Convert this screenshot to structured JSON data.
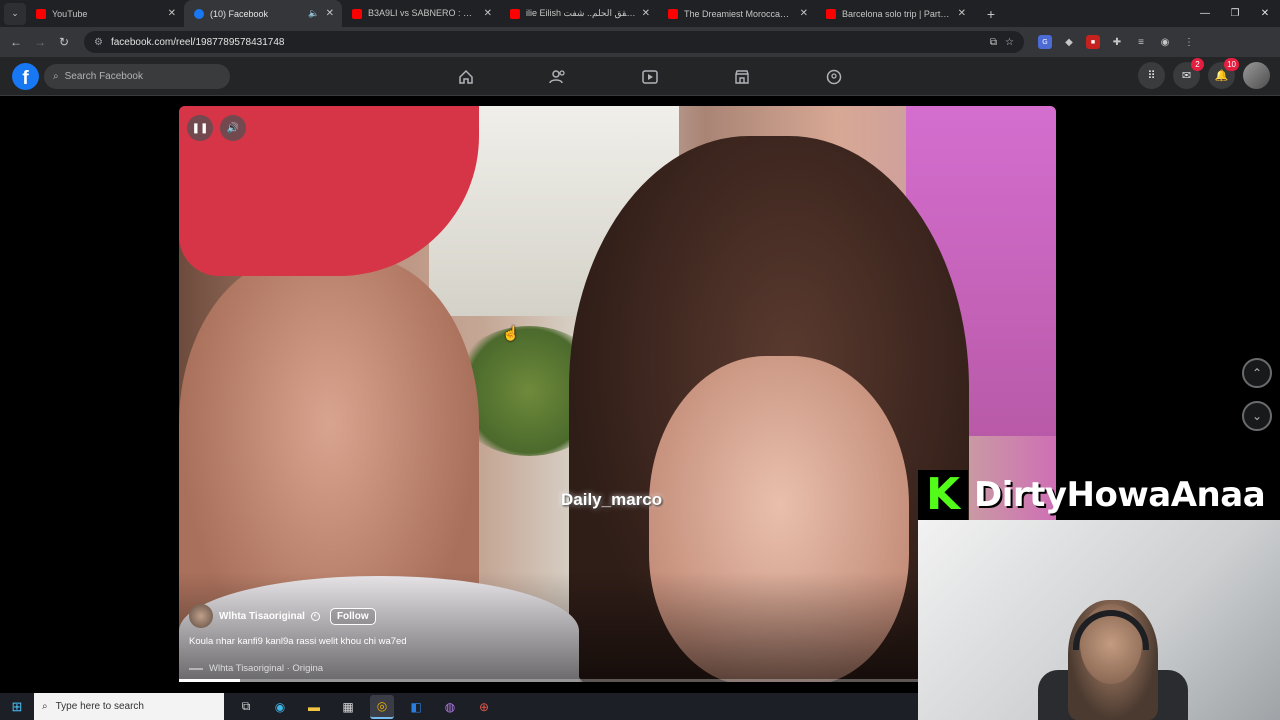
{
  "browser": {
    "tabs": [
      {
        "title": "YouTube",
        "favicon": "youtube-icon",
        "active": false
      },
      {
        "title": "(10) Facebook",
        "favicon": "facebook-icon",
        "active": true
      },
      {
        "title": "B3A9LI vs SABNERO : ع للأحداث",
        "favicon": "youtube-icon",
        "active": false
      },
      {
        "title": "ilie Eilish أخيرًا تحقق الحلم.. شفت",
        "favicon": "youtube-icon",
        "active": false
      },
      {
        "title": "The Dreamiest Moroccan Gatew",
        "favicon": "youtube-icon",
        "active": false
      },
      {
        "title": "Barcelona solo trip | Part 1 - Yo",
        "favicon": "youtube-icon",
        "active": false
      }
    ],
    "url": "facebook.com/reel/1987789578431748"
  },
  "facebook": {
    "search_placeholder": "Search Facebook",
    "messenger_badge": "2",
    "notifications_badge": "10"
  },
  "reel": {
    "watermark": "Daily_marco",
    "author": "Wlhta Tisaoriginal",
    "follow_label": "Follow",
    "caption": "Koula nhar kanfi9 kanl9a rassi welit khou chi wa7ed",
    "audio": "Wlhta Tisaoriginal · Origina",
    "progress": 0.07
  },
  "overlay": {
    "kick_letter": "K",
    "channel_name": "DirtyHowaAnaa",
    "kick_color": "#53fc18"
  },
  "taskbar": {
    "search_placeholder": "Type here to search"
  }
}
